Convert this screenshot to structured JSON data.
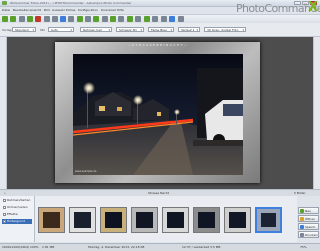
{
  "window": {
    "title": "Wohnzimmer Fotos-2013 (...) PHOTOCommander - Ashampoo Photo Commander",
    "buttons": [
      "–",
      "□",
      "✕"
    ]
  },
  "logo": {
    "text": "PhotoCommander",
    "mark": "X"
  },
  "menu": [
    "Datei",
    "Bearbeiten",
    "Ansicht",
    "Bild",
    "Auswahl",
    "Extras",
    "Konfiguration",
    "Download",
    "Hilfe"
  ],
  "toolbar": {
    "accent": "#5aa02c"
  },
  "options": {
    "label_1": "Vorlage",
    "combo_1": "Standard",
    "label_2": "Stil",
    "combo_2": "Auto",
    "combo_3": "Rahmen hell",
    "combo_4": "Schwarz 3D",
    "combo_5": "Farbe Blau",
    "combo_6": "Verlauf 1",
    "combo_7": "30 Grau, dunkel Foto"
  },
  "canvas": {
    "frame_title": "~ S T R A S S E   B E I   N A C H T ~",
    "photo_caption": "www.example.de",
    "status_left": "•",
    "status_center": "Strasse Nacht",
    "status_right": "5 Bilder"
  },
  "film_panel": {
    "items": [
      "Rahmen/Karten",
      "Ordner/Laden",
      "Effekte",
      "Hintergrund"
    ]
  },
  "side_buttons": [
    "Neu",
    "Öffnen",
    "Speich.",
    "Drucken"
  ],
  "statusbar": {
    "dimensions": "1600x1200(24bit)",
    "zoom": "100%",
    "size": "1.81 MB",
    "date": "Montag, 4. Dezember 2013, 22:18:08",
    "info": "12:37 / Lesbarkeit 3,5 MB",
    "zoom_right": "75%"
  }
}
